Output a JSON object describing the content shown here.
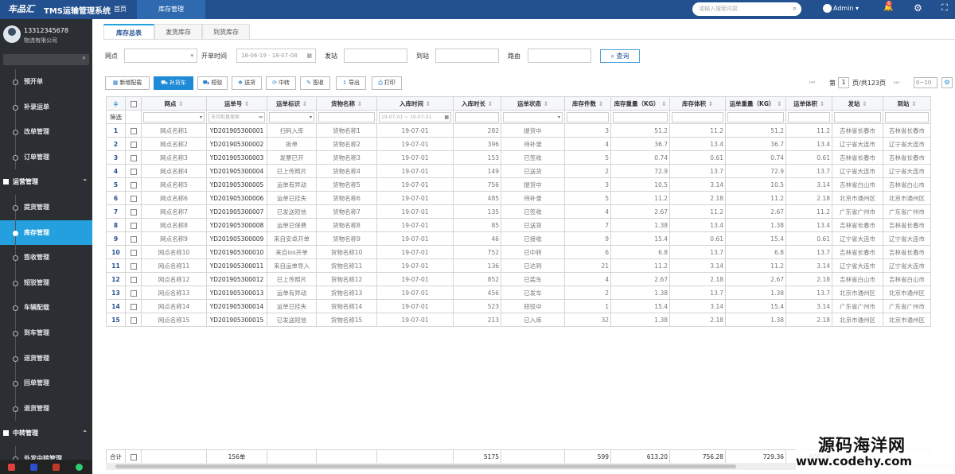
{
  "topbar": {
    "logo": "车品汇",
    "title": "TMS运输管理系统",
    "home": "首页",
    "active_tab": "库存管理",
    "search_placeholder": "请输入搜索内容",
    "user": "Admin",
    "notifications": "6"
  },
  "sidebar": {
    "phone": "13312345678",
    "org": "物流有限公司",
    "items": [
      {
        "label": "预开单",
        "type": "item"
      },
      {
        "label": "补录运单",
        "type": "item"
      },
      {
        "label": "改单管理",
        "type": "item"
      },
      {
        "label": "订单管理",
        "type": "item"
      },
      {
        "label": "运营管理",
        "type": "group"
      },
      {
        "label": "提货管理",
        "type": "item"
      },
      {
        "label": "库存管理",
        "type": "item",
        "active": true
      },
      {
        "label": "签收管理",
        "type": "item"
      },
      {
        "label": "短驳管理",
        "type": "item"
      },
      {
        "label": "车辆配载",
        "type": "item"
      },
      {
        "label": "到车管理",
        "type": "item"
      },
      {
        "label": "送货管理",
        "type": "item"
      },
      {
        "label": "回单管理",
        "type": "item"
      },
      {
        "label": "退货管理",
        "type": "item"
      },
      {
        "label": "中转管理",
        "type": "group"
      },
      {
        "label": "外发中转管理",
        "type": "item"
      }
    ]
  },
  "tabs": [
    "库存总表",
    "发货库存",
    "到货库存"
  ],
  "filters": {
    "outlet_label": "网点",
    "date_label": "开单时间",
    "date_value": "18-06-19 - 18-07-08",
    "origin_label": "发站",
    "dest_label": "到站",
    "route_label": "路由",
    "search_button": "查询"
  },
  "toolbar": {
    "buttons": [
      "新增配载",
      "补货车",
      "短驳",
      "送货",
      "中转",
      "签收",
      "导出",
      "打印"
    ],
    "page_prefix": "第",
    "page": "1",
    "page_total": "页/共123页",
    "page_size": "0~10"
  },
  "table": {
    "columns": [
      "网点",
      "运单号",
      "运单标识",
      "货物名称",
      "入库时间",
      "入库时长",
      "运单状态",
      "库存件数",
      "库存重量（KG）",
      "库存体积",
      "运单重量（KG）",
      "运单体积",
      "发站",
      "到站"
    ],
    "filter_label": "筛选",
    "filter_waybill_placeholder": "支持批量搜索",
    "filter_date_placeholder": "19-07-01 ~ 19-07-31",
    "rows": [
      [
        "1",
        "网点名称1",
        "YD201905300001",
        "扫码入库",
        "货物名称1",
        "19-07-01",
        "282",
        "提货中",
        "3",
        "51.2",
        "11.2",
        "51.2",
        "11.2",
        "吉林省长春市",
        "吉林省长春市"
      ],
      [
        "2",
        "网点名称2",
        "YD201905300002",
        "拆单",
        "货物名称2",
        "19-07-01",
        "396",
        "待补录",
        "4",
        "36.7",
        "13.4",
        "36.7",
        "13.4",
        "辽宁省大连市",
        "辽宁省大连市"
      ],
      [
        "3",
        "网点名称3",
        "YD201905300003",
        "发票已开",
        "货物名称3",
        "19-07-01",
        "153",
        "已签收",
        "5",
        "0.74",
        "0.61",
        "0.74",
        "0.61",
        "吉林省长春市",
        "吉林省长春市"
      ],
      [
        "4",
        "网点名称4",
        "YD201905300004",
        "已上传照片",
        "货物名称4",
        "19-07-01",
        "149",
        "已送货",
        "2",
        "72.9",
        "13.7",
        "72.9",
        "13.7",
        "辽宁省大连市",
        "辽宁省大连市"
      ],
      [
        "5",
        "网点名称5",
        "YD201905300005",
        "运单有异动",
        "货物名称5",
        "19-07-01",
        "756",
        "提货中",
        "3",
        "10.5",
        "3.14",
        "10.5",
        "3.14",
        "吉林省白山市",
        "吉林省白山市"
      ],
      [
        "6",
        "网点名称6",
        "YD201905300006",
        "运单已挂失",
        "货物名称6",
        "19-07-01",
        "485",
        "待补录",
        "5",
        "11.2",
        "2.18",
        "11.2",
        "2.18",
        "北京市通州区",
        "北京市通州区"
      ],
      [
        "7",
        "网点名称7",
        "YD201905300007",
        "已发送短信",
        "货物名称7",
        "19-07-01",
        "135",
        "已签收",
        "4",
        "2.67",
        "11.2",
        "2.67",
        "11.2",
        "广东省广州市",
        "广东省广州市"
      ],
      [
        "8",
        "网点名称8",
        "YD201905300008",
        "运单已保费",
        "货物名称8",
        "19-07-01",
        "85",
        "已送货",
        "7",
        "1.38",
        "13.4",
        "1.38",
        "13.4",
        "吉林省长春市",
        "吉林省长春市"
      ],
      [
        "9",
        "网点名称9",
        "YD201905300009",
        "来自安卓开单",
        "货物名称9",
        "19-07-01",
        "46",
        "已接收",
        "9",
        "15.4",
        "0.61",
        "15.4",
        "0.61",
        "辽宁省大连市",
        "辽宁省大连市"
      ],
      [
        "10",
        "网点名称10",
        "YD201905300010",
        "来自ios开单",
        "货物名称10",
        "19-07-01",
        "752",
        "已中转",
        "6",
        "6.8",
        "13.7",
        "6.8",
        "13.7",
        "吉林省长春市",
        "吉林省长春市"
      ],
      [
        "11",
        "网点名称11",
        "YD201905300011",
        "来自运单导入",
        "货物名称11",
        "19-07-01",
        "136",
        "已达到",
        "21",
        "11.2",
        "3.14",
        "11.2",
        "3.14",
        "辽宁省大连市",
        "辽宁省大连市"
      ],
      [
        "12",
        "网点名称12",
        "YD201905300012",
        "已上传照片",
        "货物名称12",
        "19-07-01",
        "852",
        "已装车",
        "4",
        "2.67",
        "2.18",
        "2.67",
        "2.18",
        "吉林省白山市",
        "吉林省白山市"
      ],
      [
        "13",
        "网点名称13",
        "YD201905300013",
        "运单有异动",
        "货物名称13",
        "19-07-01",
        "456",
        "已发车",
        "2",
        "1.38",
        "13.7",
        "1.38",
        "13.7",
        "北京市通州区",
        "北京市通州区"
      ],
      [
        "14",
        "网点名称14",
        "YD201905300014",
        "运单已挂失",
        "货物名称14",
        "19-07-01",
        "523",
        "短驳中",
        "1",
        "15.4",
        "3.14",
        "15.4",
        "3.14",
        "广东省广州市",
        "广东省广州市"
      ],
      [
        "15",
        "网点名称15",
        "YD201905300015",
        "已发送短信",
        "货物名称15",
        "19-07-01",
        "213",
        "已入库",
        "32",
        "1.38",
        "2.18",
        "1.38",
        "2.18",
        "北京市通州区",
        "北京市通州区"
      ]
    ],
    "totals": {
      "label": "合计",
      "waybill": "156单",
      "duration": "5175",
      "pieces": "599",
      "stock_weight": "613.20",
      "stock_volume": "756.28",
      "waybill_weight": "729.36",
      "waybill_volume": "606.36"
    }
  },
  "watermark": {
    "line1": "源码海洋网",
    "line2": "www.codehy.com"
  }
}
